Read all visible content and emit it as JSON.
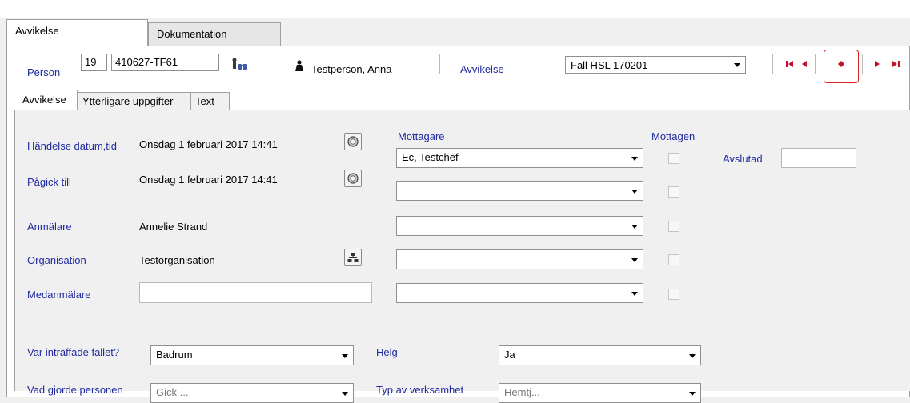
{
  "tabs": {
    "main": [
      "Avvikelse",
      "Dokumentation"
    ],
    "inner": [
      "Avvikelse",
      "Ytterligare uppgifter",
      "Text"
    ]
  },
  "person_bar": {
    "person_label": "Person",
    "person_number": "19",
    "person_id": "410627-TF61",
    "patient_name": "Testperson, Anna",
    "avvikelse_label": "Avvikelse",
    "avvikelse_value": "Fall HSL 170201 -"
  },
  "form": {
    "handelse_label": "Händelse datum,tid",
    "handelse_value": "Onsdag 1 februari 2017 14:41",
    "pagick_label": "Pågick till",
    "pagick_value": "Onsdag 1 februari 2017 14:41",
    "anmalare_label": "Anmälare",
    "anmalare_value": "Annelie Strand",
    "organisation_label": "Organisation",
    "organisation_value": "Testorganisation",
    "medanmalare_label": "Medanmälare",
    "medanmalare_value": "",
    "mottagare_label": "Mottagare",
    "mottagen_label": "Mottagen",
    "avslutad_label": "Avslutad",
    "avslutad_value": "",
    "mottagare_values": [
      "Ec, Testchef",
      "",
      "",
      "",
      ""
    ],
    "var_label": "Var inträffade fallet?",
    "var_value": "Badrum",
    "helg_label": "Helg",
    "helg_value": "Ja",
    "vad_label": "Vad gjorde personen",
    "vad_value": "Gick ...",
    "typ_label": "Typ av verksamhet",
    "typ_value": "Hemtj..."
  },
  "colors": {
    "label_blue": "#1f2aa0",
    "nav_red": "#c0102a",
    "highlight_red": "#e02020"
  },
  "icons": {
    "search_person": "binoculars-icon",
    "patient": "person-silhouette-icon",
    "clock": "clock-icon",
    "org": "org-chart-icon"
  }
}
